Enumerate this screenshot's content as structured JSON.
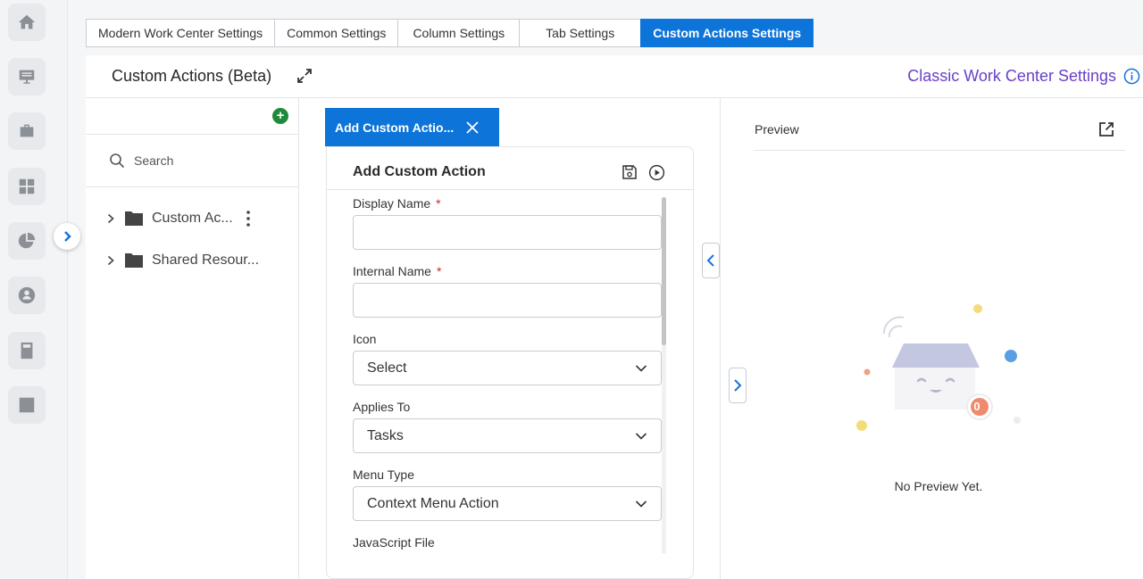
{
  "tabs": [
    {
      "label": "Modern Work Center Settings",
      "active": false
    },
    {
      "label": "Common Settings",
      "active": false
    },
    {
      "label": "Column Settings",
      "active": false
    },
    {
      "label": "Tab Settings",
      "active": false
    },
    {
      "label": "Custom Actions Settings",
      "active": true
    }
  ],
  "header": {
    "title": "Custom Actions (Beta)",
    "classic_link": "Classic Work Center Settings"
  },
  "tree": {
    "search_placeholder": "Search",
    "items": [
      {
        "label": "Custom Ac...",
        "icon": "folder-icon"
      },
      {
        "label": "Shared Resour...",
        "icon": "folder-icon"
      }
    ]
  },
  "form": {
    "tab_label": "Add Custom Actio...",
    "card_title": "Add Custom Action",
    "fields": {
      "display_name": {
        "label": "Display Name",
        "required": "*",
        "value": ""
      },
      "internal_name": {
        "label": "Internal Name",
        "required": "*",
        "value": ""
      },
      "icon": {
        "label": "Icon",
        "value": "Select"
      },
      "applies_to": {
        "label": "Applies To",
        "value": "Tasks"
      },
      "menu_type": {
        "label": "Menu Type",
        "value": "Context Menu Action"
      },
      "javascript_file": {
        "label": "JavaScript File"
      }
    }
  },
  "preview": {
    "title": "Preview",
    "empty_text": "No Preview Yet.",
    "badge_count": "0"
  },
  "colors": {
    "accent": "#0d74d9",
    "link": "#6a3fc8",
    "add": "#1f8a3a",
    "required": "#c62828"
  }
}
